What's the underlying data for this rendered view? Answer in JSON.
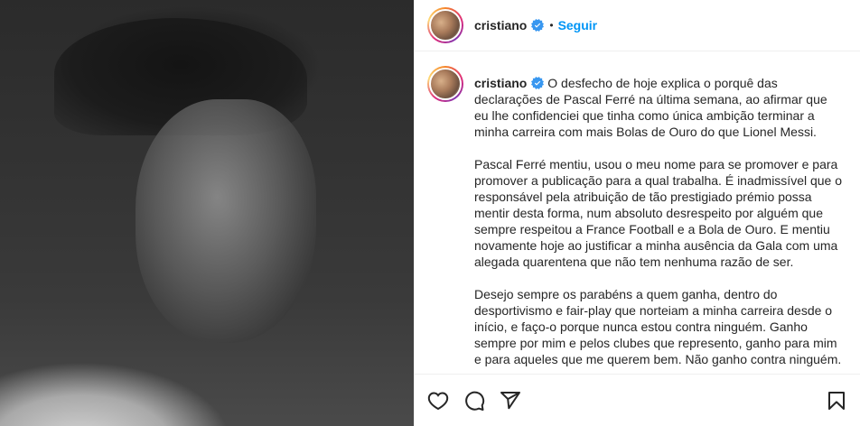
{
  "post": {
    "username": "cristiano",
    "follow_label": "Seguir",
    "separator": "•"
  },
  "caption": {
    "username": "cristiano",
    "paragraphs": [
      "O desfecho de hoje explica o porquê das declarações de Pascal Ferré na última semana, ao afirmar que eu lhe confidenciei que tinha como única ambição terminar a minha carreira com mais Bolas de Ouro do que Lionel Messi.",
      "Pascal Ferré mentiu, usou o meu nome para se promover e para promover a publicação para a qual trabalha. É inadmissível que o responsável pela atribuição de tão prestigiado prémio possa mentir desta forma, num absoluto desrespeito por alguém que sempre respeitou a France Football e a Bola de Ouro. E mentiu novamente hoje ao justificar a minha ausência da Gala com uma alegada quarentena que não tem nenhuma razão de ser.",
      "Desejo sempre os parabéns a quem ganha, dentro do desportivismo e fair-play que norteiam a minha carreira desde o início, e faço-o porque nunca estou contra ninguém. Ganho sempre por mim e pelos clubes que represento, ganho para mim e para aqueles que me querem bem. Não ganho contra ninguém."
    ]
  },
  "icons": {
    "like": "heart-icon",
    "comment": "comment-icon",
    "share": "share-icon",
    "save": "bookmark-icon",
    "verified": "verified-badge-icon"
  },
  "colors": {
    "accent": "#0095f6",
    "text": "#262626",
    "border": "#efefef"
  }
}
